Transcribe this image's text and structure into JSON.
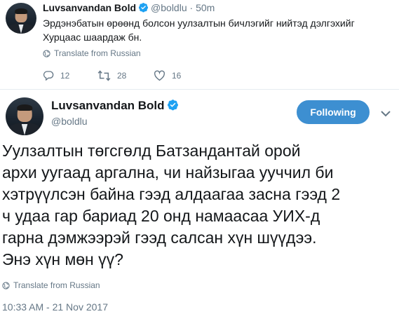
{
  "tweet_prev": {
    "author_name": "Luvsanvandan Bold",
    "handle": "@boldlu",
    "separator": "·",
    "time": "50m",
    "text": "Эрдэнэбатын өрөөнд болсон уулзалтын бичлэгийг нийтэд дэлгэхийг Хурцаас шаардаж бн.",
    "translate_label": "Translate from Russian",
    "replies": "12",
    "retweets": "28",
    "likes": "16"
  },
  "tweet_main": {
    "author_name": "Luvsanvandan Bold",
    "handle": "@boldlu",
    "follow_label": "Following",
    "text": "Уулзалтын төгсгөлд Батзандантай орой\nархи уугаад аргална, чи найзыгаа ууччил би\nхэтрүүлсэн байна гээд алдаагаа засна гээд 2\nч удаа гар бариад 20 онд намаасаа УИХ-д\nгарна дэмжээрэй гээд салсан хүн шүүдээ.\nЭнэ хүн мөн үү?",
    "translate_label": "Translate from Russian",
    "timestamp": "10:33 AM - 21 Nov 2017"
  },
  "colors": {
    "accent": "#1da1f2",
    "follow_bg": "#3d8fd1",
    "muted": "#657786",
    "text": "#14171a"
  },
  "icons": [
    "verified-icon",
    "globe-icon",
    "reply-icon",
    "retweet-icon",
    "like-icon",
    "chevron-down-icon"
  ]
}
